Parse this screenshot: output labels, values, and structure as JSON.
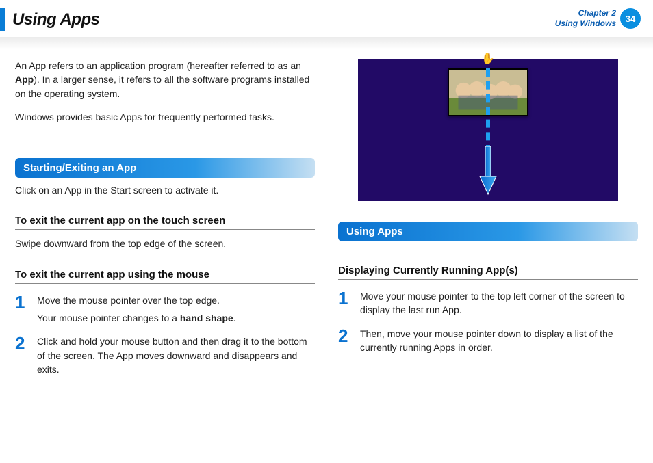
{
  "header": {
    "title": "Using Apps",
    "chapter_line1": "Chapter 2",
    "chapter_line2": "Using Windows",
    "page_number": "34"
  },
  "left": {
    "intro_before_bold": "An App refers to an application program (hereafter referred to as an ",
    "intro_bold": "App",
    "intro_after_bold": "). In a larger sense, it refers to all the software programs installed on the operating system.",
    "intro_p2": "Windows provides basic Apps for frequently performed tasks.",
    "heading1": "Starting/Exiting an App",
    "heading1_text": "Click on an App in the Start screen to activate it.",
    "sub1": "To exit the current app on the touch screen",
    "sub1_text": "Swipe downward from the top edge of the screen.",
    "sub2": "To exit the current app using the mouse",
    "steps": [
      {
        "num": "1",
        "p1": "Move the mouse pointer over the top edge.",
        "p2_before_bold": "Your mouse pointer changes to a ",
        "p2_bold": "hand shape",
        "p2_after_bold": "."
      },
      {
        "num": "2",
        "p1": "Click and hold your mouse button and then drag it to the bottom of the screen. The App moves downward and disappears and exits."
      }
    ]
  },
  "right": {
    "heading1": "Using Apps",
    "sub1": "Displaying Currently Running App(s)",
    "steps": [
      {
        "num": "1",
        "p1": "Move your mouse pointer to the top left corner of the screen to display the last run App."
      },
      {
        "num": "2",
        "p1": "Then, move your mouse pointer down to display a list of the currently running Apps in order."
      }
    ]
  }
}
